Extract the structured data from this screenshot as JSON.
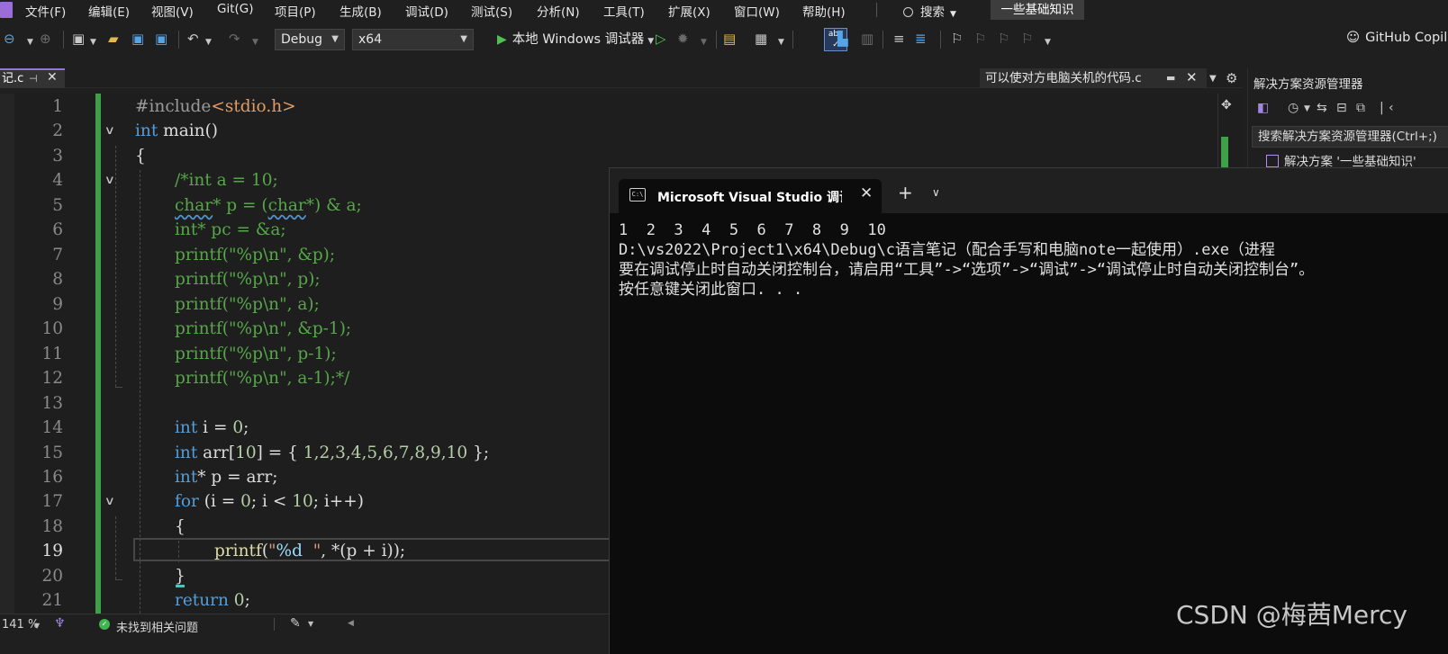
{
  "menubar": {
    "items": [
      "文件(F)",
      "编辑(E)",
      "视图(V)",
      "Git(G)",
      "项目(P)",
      "生成(B)",
      "调试(D)",
      "测试(S)",
      "分析(N)",
      "工具(T)",
      "扩展(X)",
      "窗口(W)",
      "帮助(H)"
    ],
    "search_label": "搜索",
    "solution_name": "一些基础知识"
  },
  "toolbar": {
    "config": "Debug",
    "platform": "x64",
    "run_label": "本地 Windows 调试器",
    "copilot_label": "GitHub Copilot"
  },
  "tabs": {
    "active_tab": "记.c",
    "right_tab": "可以使对方电脑关机的代码.c"
  },
  "editor": {
    "line_numbers": [
      "1",
      "2",
      "3",
      "4",
      "5",
      "6",
      "7",
      "8",
      "9",
      "10",
      "11",
      "12",
      "13",
      "14",
      "15",
      "16",
      "17",
      "18",
      "19",
      "20",
      "21"
    ],
    "current_line": "19",
    "code": {
      "l1_include": "#include",
      "l1_header": "<stdio.h>",
      "l2_kw": "int",
      "l2_rest": " main()",
      "l3": "{",
      "l4": "/*int a = 10;",
      "l5_a": "char",
      "l5_b": "* p = (",
      "l5_c": "char",
      "l5_d": "*) & a;",
      "l6": "int* pc = &a;",
      "l7": "printf(\"%p\\n\", &p);",
      "l8": "printf(\"%p\\n\", p);",
      "l9": "printf(\"%p\\n\", a);",
      "l10": "printf(\"%p\\n\", &p-1);",
      "l11": "printf(\"%p\\n\", p-1);",
      "l12": "printf(\"%p\\n\", a-1);*/",
      "l14_kw": "int",
      "l14_rest": " i = ",
      "l14_num": "0",
      "l14_end": ";",
      "l15_kw": "int",
      "l15_rest": " arr[",
      "l15_num": "10",
      "l15_mid": "] = { ",
      "l15_vals": "1,2,3,4,5,6,7,8,9,10",
      "l15_end": " };",
      "l16_kw": "int",
      "l16_rest": "* p = arr;",
      "l17_kw": "for",
      "l17_a": " (i = ",
      "l17_n0": "0",
      "l17_b": "; i < ",
      "l17_n10": "10",
      "l17_c": "; i++)",
      "l18": "{",
      "l19_fn": "printf",
      "l19_a": "(",
      "l19_str1": "\"",
      "l19_fmt": "%d",
      "l19_str2": "  \"",
      "l19_b": ", *(p + i));",
      "l20": "}",
      "l21_kw": "return",
      "l21_a": " ",
      "l21_num": "0",
      "l21_b": ";"
    }
  },
  "solution_explorer": {
    "title": "解决方案资源管理器",
    "search_placeholder": "搜索解决方案资源管理器(Ctrl+;)",
    "item": "解决方案 '一些基础知识'"
  },
  "statusbar": {
    "zoom": "141 %",
    "issues": "未找到相关问题"
  },
  "console": {
    "tab_title": "Microsoft Visual Studio 调试控制台",
    "lines": [
      "1  2  3  4  5  6  7  8  9  10",
      "D:\\vs2022\\Project1\\x64\\Debug\\c语言笔记（配合手写和电脑note一起使用）.exe（进程",
      "要在调试停止时自动关闭控制台，请启用“工具”->“选项”->“调试”->“调试停止时自动关闭控制台”。",
      "按任意键关闭此窗口. . ."
    ]
  },
  "watermark": "CSDN @梅茜Mercy",
  "colors": {
    "accent": "#9277d8",
    "change_bar": "#3fa04a",
    "comment": "#57a64a",
    "keyword": "#569cd6"
  }
}
